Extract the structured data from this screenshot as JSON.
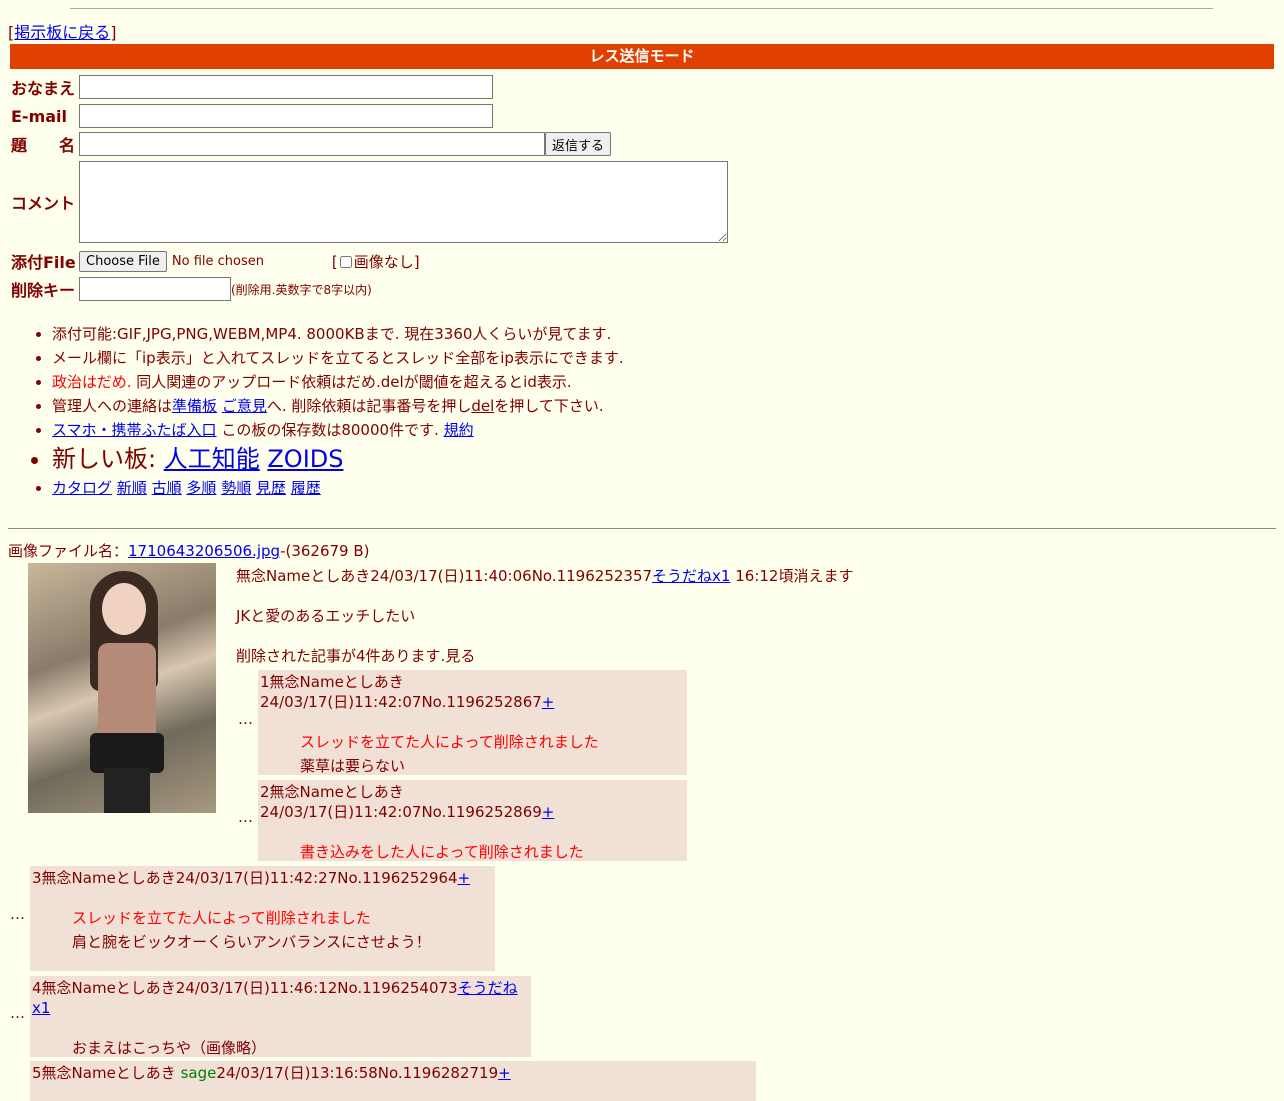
{
  "back_link": "掲示板に戻る",
  "mode_title": "レス送信モード",
  "form": {
    "name_label": "おなまえ",
    "email_label": "E-mail",
    "subject_label": "題　　名",
    "submit_label": "返信する",
    "comment_label": "コメント",
    "file_label": "添付File",
    "file_button": "Choose File",
    "file_status": "No file chosen",
    "noimage_label": "画像なし",
    "delkey_label": "削除キー",
    "delkey_note": "(削除用.英数字で8字以内)"
  },
  "info": {
    "line1": "添付可能:GIF,JPG,PNG,WEBM,MP4. 8000KBまで. 現在3360人くらいが見てます.",
    "line2": "メール欄に「ip表示」と入れてスレッドを立てるとスレッド全部をip表示にできます.",
    "line3_red": "政治はだめ.",
    "line3_rest": " 同人関連のアップロード依頼はだめ.delが閾値を超えるとid表示.",
    "line4_a": "管理人への連絡は",
    "line4_link1": "準備板",
    "line4_link2": "ご意見",
    "line4_b": "へ. 削除依頼は記事番号を押し",
    "line4_link3": "del",
    "line4_c": "を押して下さい.",
    "line5_link": "スマホ・携帯ふたば入口",
    "line5_text": " この板の保存数は80000件です. ",
    "line5_link2": "規約",
    "line6_label": "新しい板: ",
    "line6_link1": "人工知能",
    "line6_link2": "ZOIDS",
    "nav": [
      "カタログ",
      "新順",
      "古順",
      "多順",
      "勢順",
      "見歴",
      "履歴"
    ]
  },
  "fileinfo": {
    "label": "画像ファイル名：",
    "filename": "1710643206506.jpg",
    "size": "-(362679 B)"
  },
  "op": {
    "header": "無念Nameとしあき24/03/17(日)11:40:06No.1196252357",
    "soudane": "そうだね",
    "soudane_count": "x1",
    "expire": " 16:12頃消えます",
    "text": "JKと愛のあるエッチしたい",
    "deleted_note": "削除された記事が4件あります.見る"
  },
  "replies": [
    {
      "header": "1無念Nameとしあき24/03/17(日)11:42:07No.1196252867",
      "plus": "+",
      "line1": "スレッドを立てた人によって削除されました",
      "line2": "薬草は要らない"
    },
    {
      "header": "2無念Nameとしあき24/03/17(日)11:42:07No.1196252869",
      "plus": "+",
      "line1": "書き込みをした人によって削除されました",
      "line2": ""
    },
    {
      "header": "3無念Nameとしあき24/03/17(日)11:42:27No.1196252964",
      "plus": "+",
      "line1": "スレッドを立てた人によって削除されました",
      "line2": "肩と腕をビックオーくらいアンバランスにさせよう！"
    },
    {
      "header": "4無念Nameとしあき24/03/17(日)11:46:12No.1196254073",
      "plus": "そうだねx1",
      "line1": "",
      "line2": "おまえはこっちや（画像略）"
    },
    {
      "header_a": "5無念Nameとしあき ",
      "sage": "sage",
      "header_b": "24/03/17(日)13:16:58No.1196282719",
      "plus": "+"
    }
  ],
  "dots": "…",
  "colors": {
    "bg": "#ffffee",
    "text": "#800000",
    "bar": "#e04000",
    "reply_bg": "#f0e0d6",
    "red": "#ff0000",
    "link": "#0000ee"
  }
}
